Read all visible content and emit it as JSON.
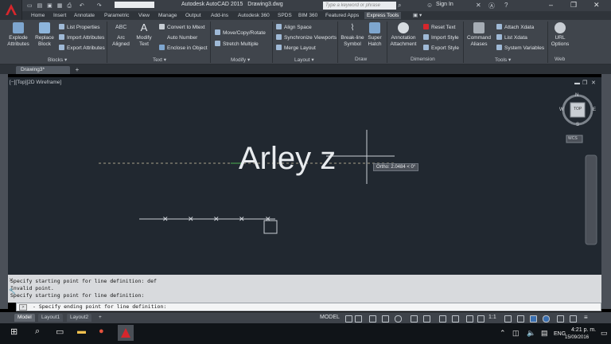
{
  "titlebar": {
    "app_title": "Autodesk AutoCAD 2015",
    "doc_name": "Drawing3.dwg",
    "search_placeholder": "Type a keyword or phrase",
    "signin_label": "Sign In"
  },
  "ribbon_tabs": [
    "Home",
    "Insert",
    "Annotate",
    "Parametric",
    "View",
    "Manage",
    "Output",
    "Add-ins",
    "Autodesk 360",
    "SPDS",
    "BIM 360",
    "Featured Apps",
    "Express Tools"
  ],
  "active_ribbon_tab": "Express Tools",
  "ribbon": {
    "blocks": {
      "title": "Blocks",
      "explode": "Explode Attributes",
      "replace": "Replace Block",
      "list_props": "List Properties",
      "import_attr": "Import Attributes",
      "export_attr": "Export Attributes"
    },
    "text": {
      "title": "Text",
      "arc_aligned": "Arc Aligned",
      "modify_text": "Modify Text",
      "convert_mtext": "Convert to Mtext",
      "auto_number": "Auto Number",
      "enclose": "Enclose in Object"
    },
    "modify": {
      "title": "Modify",
      "move_copy_rotate": "Move/Copy/Rotate",
      "stretch_multiple": "Stretch Multiple"
    },
    "layout": {
      "title": "Layout",
      "align_space": "Align Space",
      "sync_viewports": "Synchronize Viewports",
      "merge_layout": "Merge Layout"
    },
    "draw": {
      "title": "Draw",
      "breakline": "Break-line Symbol",
      "super_hatch": "Super Hatch"
    },
    "dimension": {
      "title": "Dimension",
      "annotation_attachment": "Annotation Attachment",
      "reset_text": "Reset Text",
      "import_style": "Import Style",
      "export_style": "Export Style"
    },
    "tools": {
      "title": "Tools",
      "command_aliases": "Command Aliases",
      "attach_xdata": "Attach Xdata",
      "list_xdata": "List Xdata",
      "system_variables": "System Variables"
    },
    "web": {
      "title": "Web",
      "url_options": "URL Options"
    }
  },
  "doc_tab": "Drawing3*",
  "viewport": {
    "label": "[−][Top][2D Wireframe]",
    "text_object": "Arley z",
    "ortho_tooltip": "Ortho: 2.0484 < 0°",
    "viewcube_top": "TOP",
    "compass_n": "N",
    "compass_s": "S",
    "compass_e": "E",
    "compass_w": "W",
    "wcs": "WCS"
  },
  "command_history": [
    "Specify starting point for line definition: def",
    "Invalid point.",
    "Specify starting point for line definition:"
  ],
  "command_prompt": "- Specify ending point for line definition:",
  "layout_tabs": [
    "Model",
    "Layout1",
    "Layout2"
  ],
  "active_layout_tab": "Model",
  "status": {
    "space": "MODEL",
    "scale": "1:1"
  },
  "taskbar": {
    "language": "ENG",
    "time": "4:21 p. m.",
    "date": "15/09/2016"
  },
  "colors": {
    "canvas": "#212830",
    "ribbon": "#40454c",
    "accent_red": "#d6262c"
  }
}
